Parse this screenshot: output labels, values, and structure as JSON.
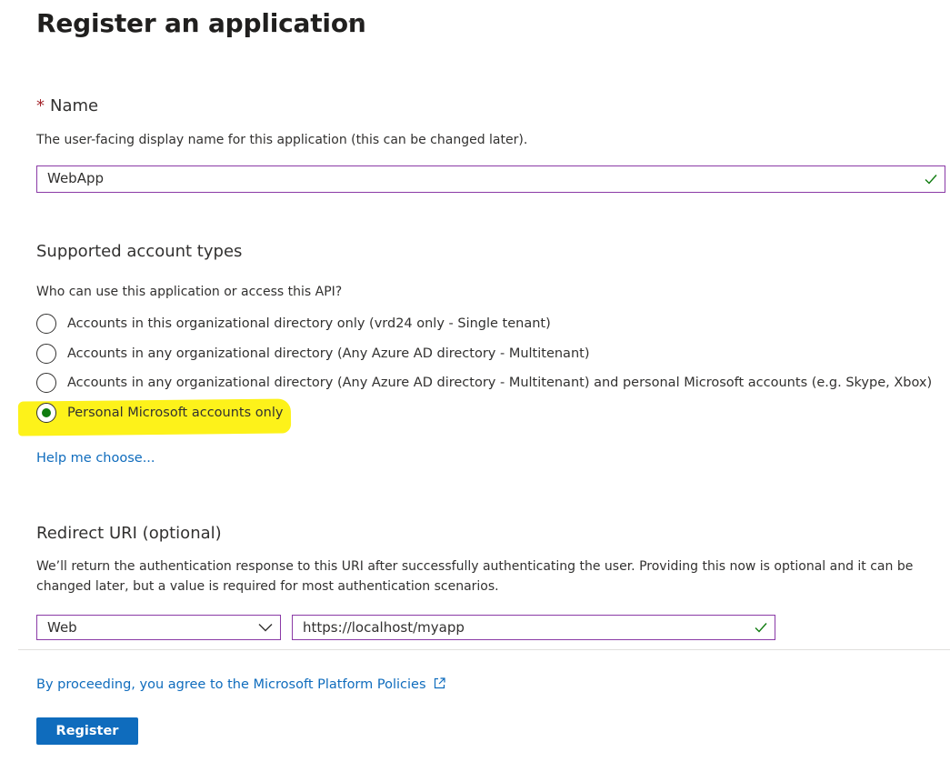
{
  "page": {
    "title": "Register an application",
    "more": "···"
  },
  "name_section": {
    "required_marker": "*",
    "heading": "Name",
    "description": "The user-facing display name for this application (this can be changed later).",
    "input_value": "WebApp"
  },
  "account_types": {
    "heading": "Supported account types",
    "question": "Who can use this application or access this API?",
    "options": [
      {
        "label": "Accounts in this organizational directory only (vrd24 only - Single tenant)",
        "selected": false
      },
      {
        "label": "Accounts in any organizational directory (Any Azure AD directory - Multitenant)",
        "selected": false
      },
      {
        "label": "Accounts in any organizational directory (Any Azure AD directory - Multitenant) and personal Microsoft accounts (e.g. Skype, Xbox)",
        "selected": false
      },
      {
        "label": "Personal Microsoft accounts only",
        "selected": true
      }
    ],
    "help_link": "Help me choose..."
  },
  "redirect": {
    "heading": "Redirect URI (optional)",
    "description": "We’ll return the authentication response to this URI after successfully authenticating the user. Providing this now is optional and it can be changed later, but a value is required for most authentication scenarios.",
    "platform_value": "Web",
    "uri_value": "https://localhost/myapp"
  },
  "footer": {
    "policy_link": "By proceeding, you agree to the Microsoft Platform Policies",
    "register_label": "Register"
  },
  "colors": {
    "accent": "#0f6cbd",
    "valid_check": "#107c10",
    "input_border": "#8a3aa6",
    "highlight": "#fdf21a"
  }
}
